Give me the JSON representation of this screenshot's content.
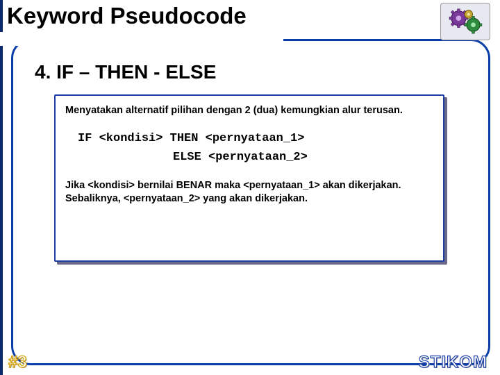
{
  "title": "Keyword Pseudocode",
  "section_heading": "4. IF – THEN - ELSE",
  "box": {
    "description": "Menyatakan alternatif pilihan dengan 2 (dua) kemungkian alur terusan.",
    "code_line1": "IF <kondisi> THEN <pernyataan_1>",
    "code_line2": "ELSE <pernyataan_2>",
    "explanation": "Jika <kondisi> bernilai BENAR maka <pernyataan_1> akan dikerjakan. Sebaliknya, <pernyataan_2> yang akan dikerjakan."
  },
  "slide_number": "#3",
  "brand": "STIKOM",
  "icon_name": "gears-icon"
}
